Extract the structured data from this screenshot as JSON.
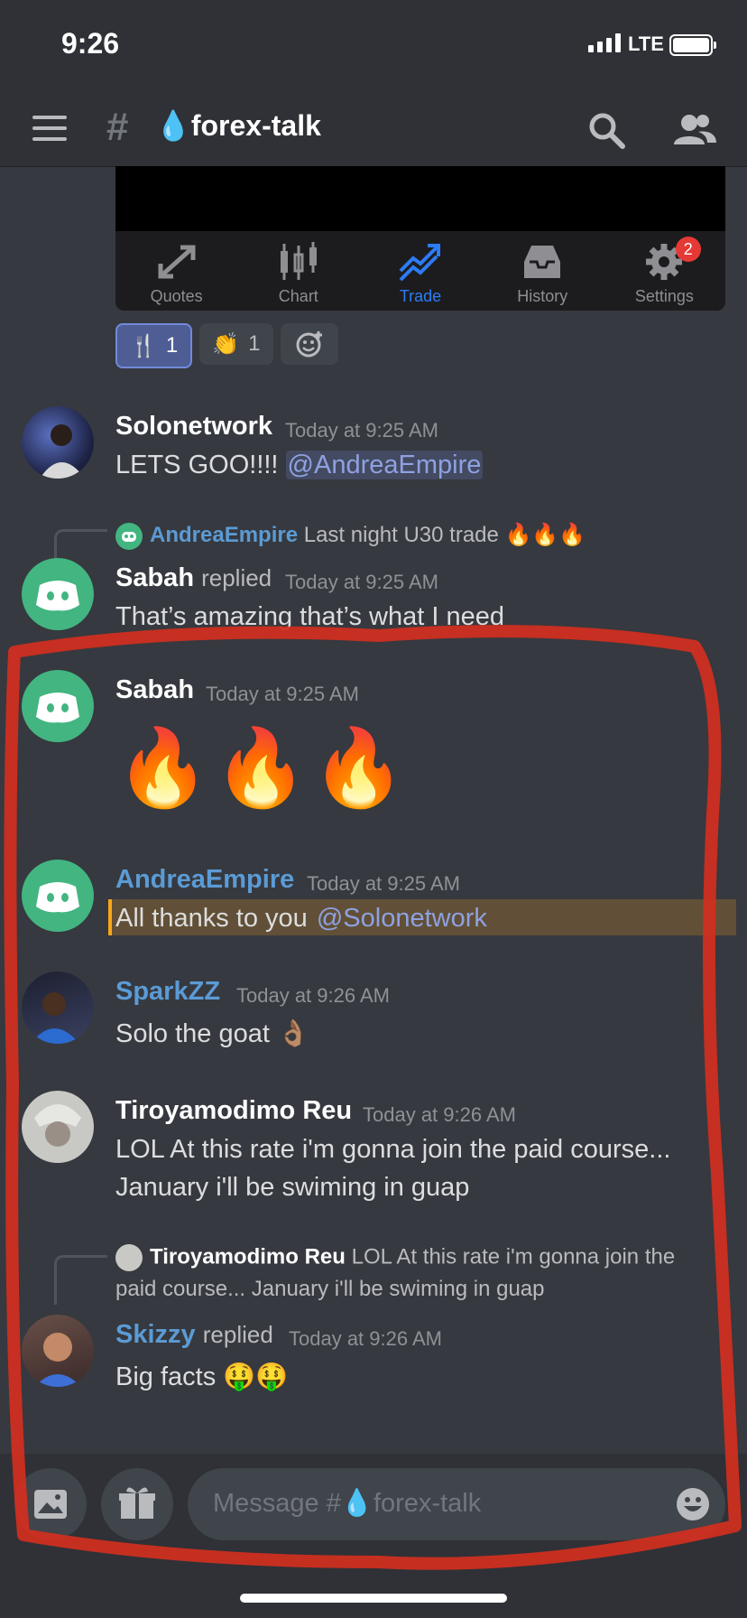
{
  "status": {
    "time": "9:26",
    "network": "LTE"
  },
  "header": {
    "channel_name": "forex-talk"
  },
  "embed_tabs": [
    {
      "label": "Quotes",
      "icon": "arrows-icon"
    },
    {
      "label": "Chart",
      "icon": "candlestick-icon"
    },
    {
      "label": "Trade",
      "icon": "trend-icon",
      "active": true
    },
    {
      "label": "History",
      "icon": "inbox-icon"
    },
    {
      "label": "Settings",
      "icon": "gear-icon",
      "badge": "2"
    }
  ],
  "reactions": [
    {
      "emoji": "🍴",
      "count": "1"
    },
    {
      "emoji": "👏",
      "count": "1"
    }
  ],
  "messages": [
    {
      "author": "Solonetwork",
      "time": "Today at 9:25 AM",
      "text": "LETS GOO!!!! ",
      "mention": "@AndreaEmpire"
    },
    {
      "reply_author": "AndreaEmpire",
      "reply_text": "Last night U30 trade 🔥🔥🔥",
      "author": "Sabah",
      "replied": "replied",
      "time": "Today at 9:25 AM",
      "text": "That’s amazing that’s what I need"
    },
    {
      "author": "Sabah",
      "time": "Today at 9:25 AM",
      "text": "🔥🔥🔥"
    },
    {
      "author": "AndreaEmpire",
      "time": "Today at 9:25 AM",
      "text": "All thanks to you ",
      "mention": "@Solonetwork"
    },
    {
      "author": "SparkZZ",
      "time": "Today at 9:26 AM",
      "text": "Solo the goat 👌🏽"
    },
    {
      "author": "Tiroyamodimo Reu",
      "time": "Today at 9:26 AM",
      "text_line1": "LOL At this rate i'm gonna join the paid course...",
      "text_line2": "January i'll be swiming in guap"
    },
    {
      "reply_author": "Tiroyamodimo Reu",
      "reply_text_line1": "LOL At this rate i'm gonna join the",
      "reply_text_line2": "paid course... January i'll be swiming in guap",
      "author": "Skizzy",
      "replied": "replied",
      "time": "Today at 9:26 AM",
      "text": "Big facts 🤑🤑"
    }
  ],
  "composer": {
    "placeholder": "Message #💧forex-talk"
  },
  "colors": {
    "background": "#36393f",
    "link_blue": "#5b9bd5",
    "annotation_red": "#d32f1e"
  }
}
